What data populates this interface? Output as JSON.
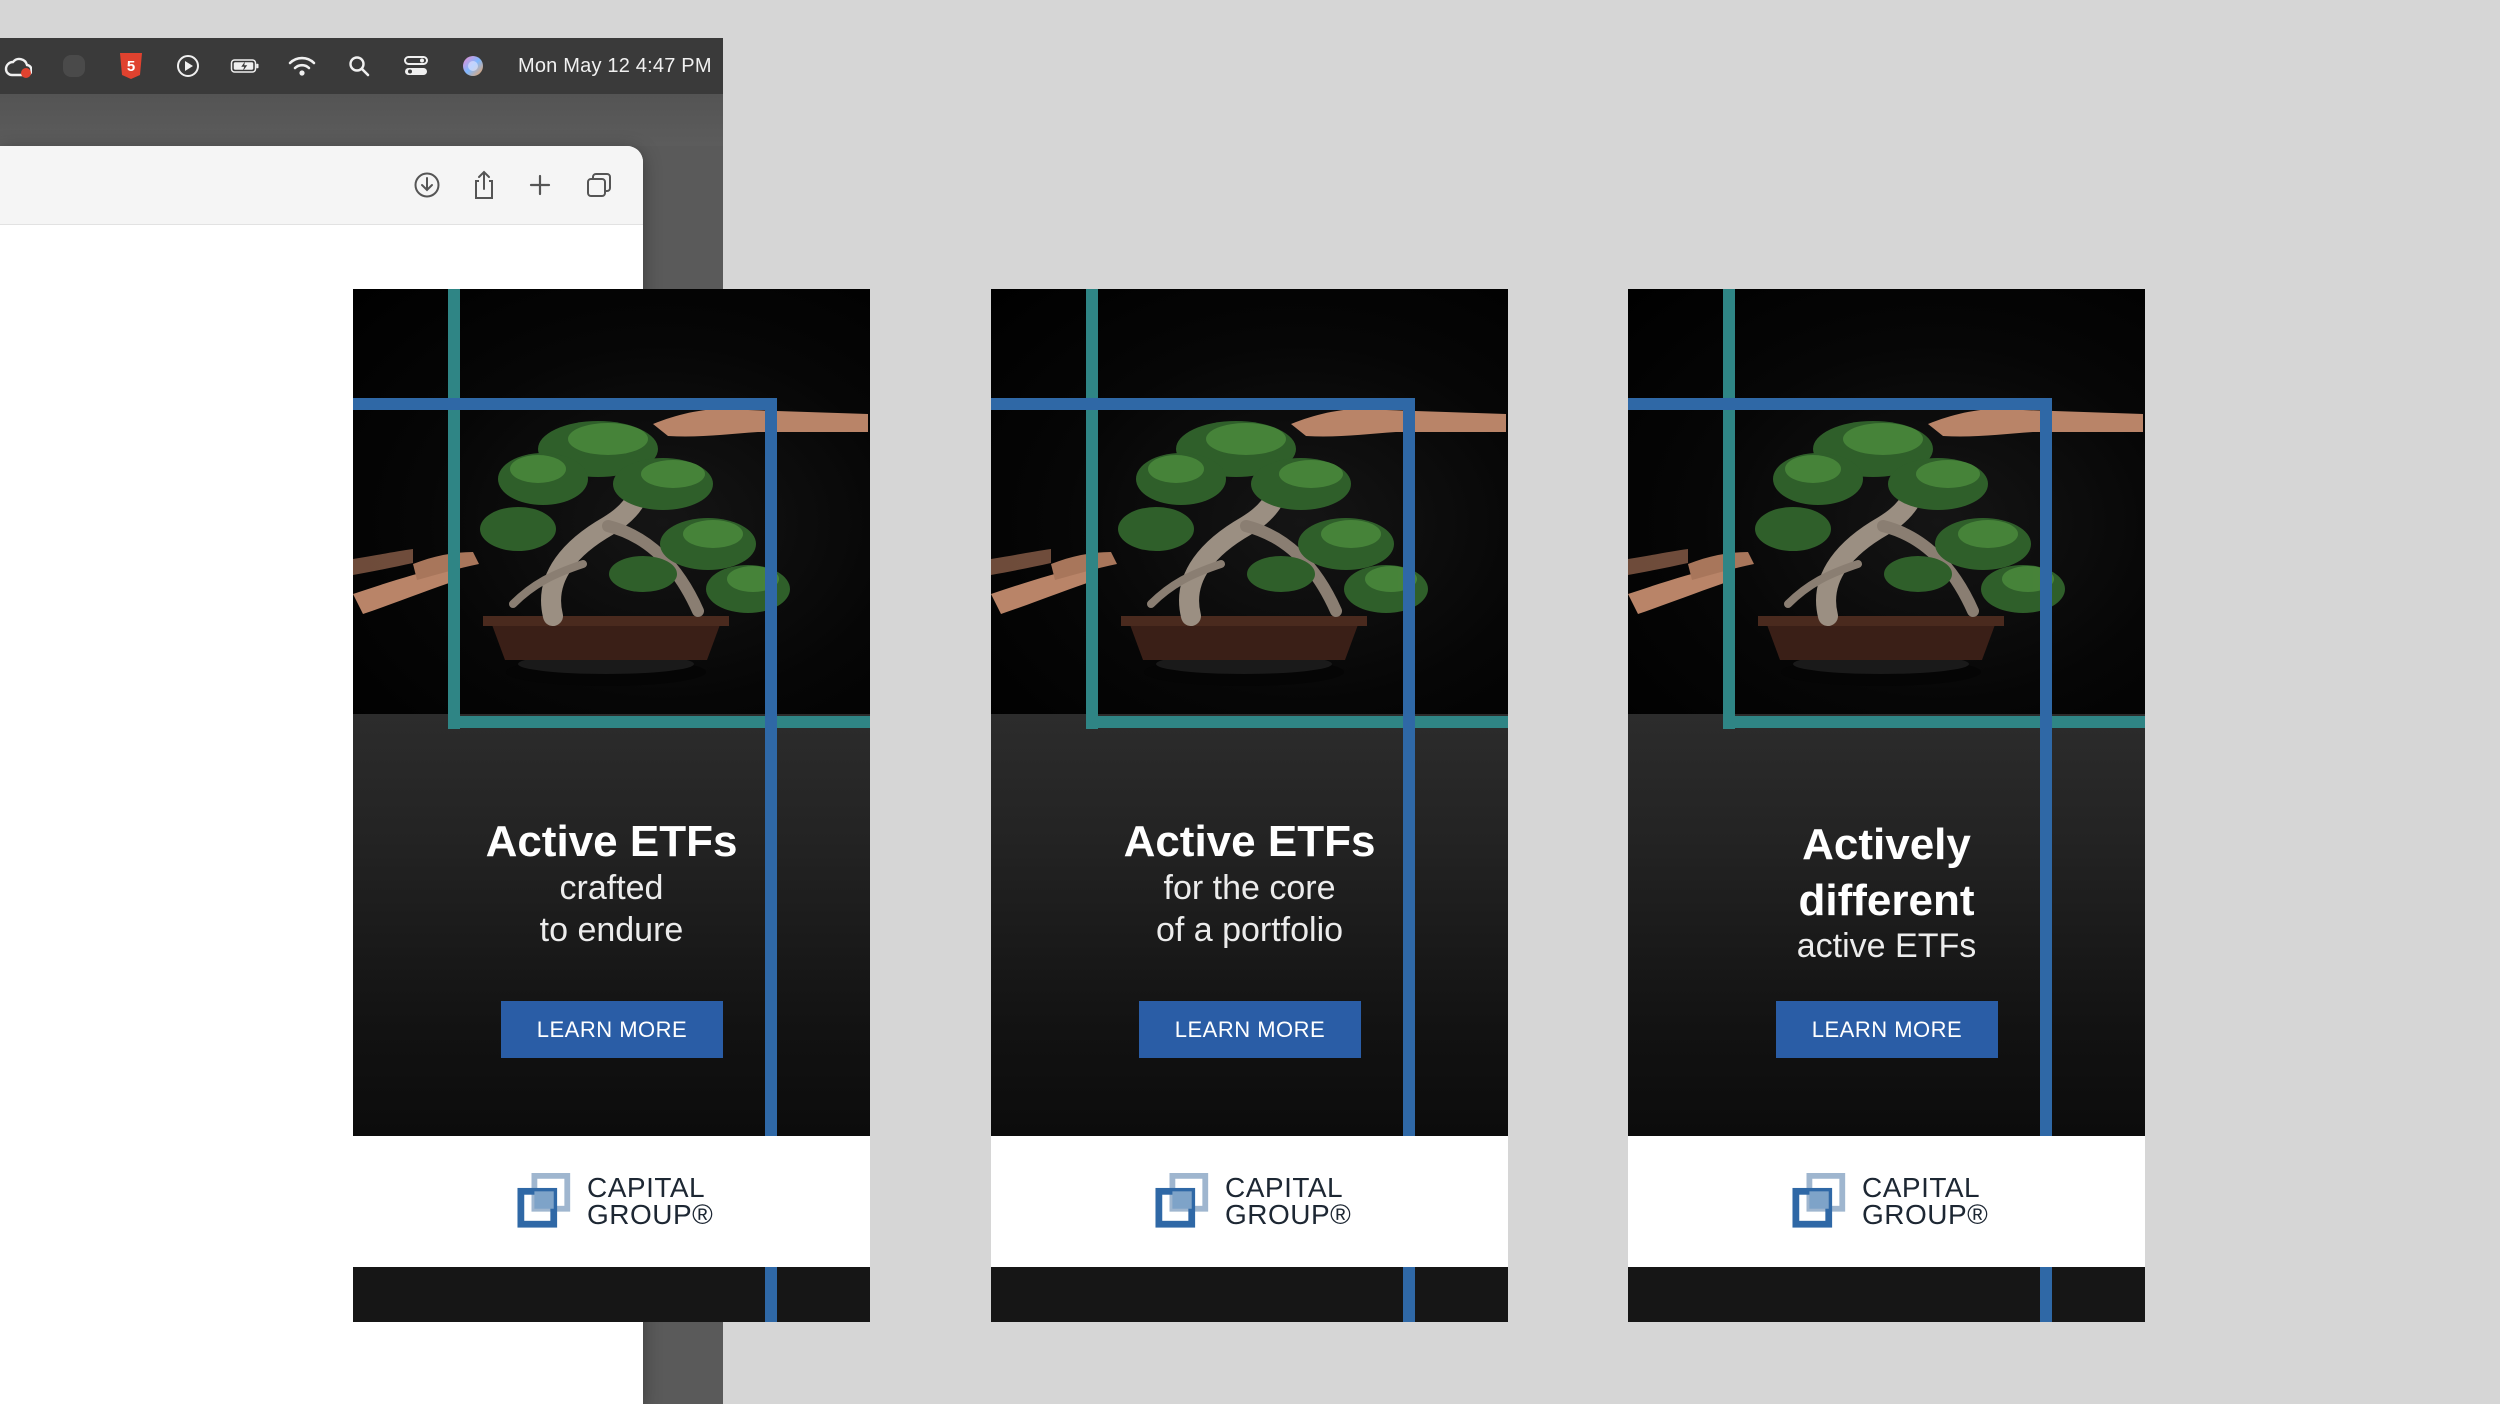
{
  "menubar": {
    "clock": "Mon May 12  4:47 PM",
    "icons": [
      "creative-cloud-icon",
      "dark-app-icon",
      "html5-icon",
      "play-icon",
      "battery-icon",
      "wifi-icon",
      "search-icon",
      "control-center-icon",
      "siri-icon"
    ]
  },
  "browser_toolbar": {
    "icons": [
      "download-icon",
      "share-icon",
      "new-tab-icon",
      "tabs-overview-icon"
    ]
  },
  "ads": [
    {
      "headline_lines": [
        "Active ETFs"
      ],
      "sub_lines": [
        "crafted",
        "to endure"
      ],
      "cta_label": "LEARN MORE",
      "brand_line1": "CAPITAL",
      "brand_line2": "GROUP®"
    },
    {
      "headline_lines": [
        "Active ETFs"
      ],
      "sub_lines": [
        "for the core",
        "of a portfolio"
      ],
      "cta_label": "LEARN MORE",
      "brand_line1": "CAPITAL",
      "brand_line2": "GROUP®"
    },
    {
      "headline_lines": [
        "Actively",
        "different"
      ],
      "sub_lines": [
        "active ETFs"
      ],
      "cta_label": "LEARN MORE",
      "brand_line1": "CAPITAL",
      "brand_line2": "GROUP®"
    }
  ],
  "colors": {
    "teal_frame": "#2f8585",
    "blue_frame": "#2f68a6",
    "cta_background": "#2a5da6",
    "desktop_background": "#d6d6d6"
  }
}
